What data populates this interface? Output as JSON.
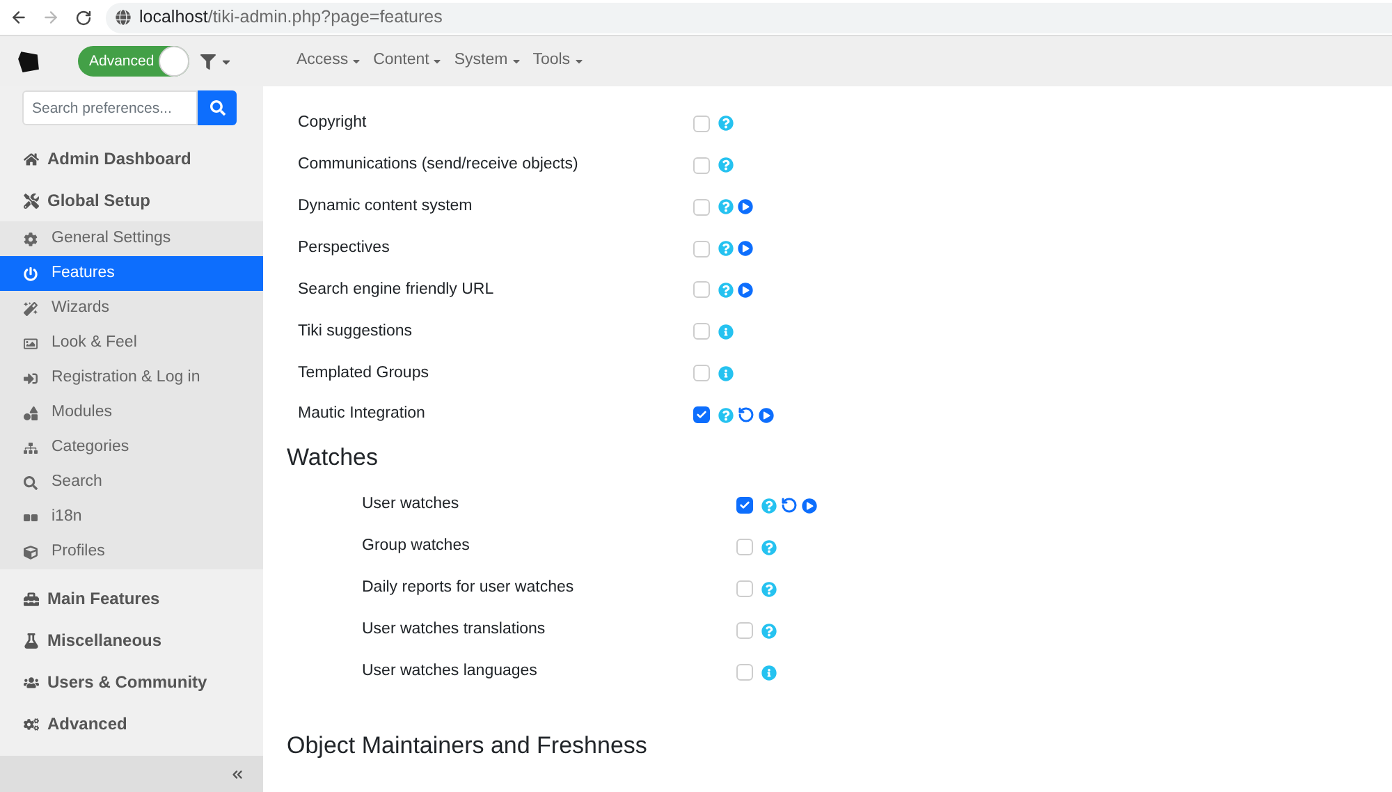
{
  "browser": {
    "url": {
      "host": "localhost",
      "path": "/tiki-admin.php?page=features"
    }
  },
  "topbar": {
    "mode_toggle": {
      "label": "Advanced",
      "on": true
    },
    "menus": [
      {
        "label": "Access"
      },
      {
        "label": "Content"
      },
      {
        "label": "System"
      },
      {
        "label": "Tools"
      }
    ]
  },
  "sidebar": {
    "search": {
      "placeholder": "Search preferences..."
    },
    "sections": [
      {
        "label": "Admin Dashboard"
      },
      {
        "label": "Global Setup",
        "children": [
          {
            "label": "General Settings",
            "selected": false
          },
          {
            "label": "Features",
            "selected": true
          },
          {
            "label": "Wizards",
            "selected": false
          },
          {
            "label": "Look & Feel",
            "selected": false
          },
          {
            "label": "Registration & Log in",
            "selected": false
          },
          {
            "label": "Modules",
            "selected": false
          },
          {
            "label": "Categories",
            "selected": false
          },
          {
            "label": "Search",
            "selected": false
          },
          {
            "label": "i18n",
            "selected": false
          },
          {
            "label": "Profiles",
            "selected": false
          }
        ]
      },
      {
        "label": "Main Features"
      },
      {
        "label": "Miscellaneous"
      },
      {
        "label": "Users & Community"
      },
      {
        "label": "Advanced"
      }
    ]
  },
  "content": {
    "preferences": [
      {
        "label": "Copyright",
        "checked": false,
        "actions": [
          {
            "kind": "help"
          }
        ]
      },
      {
        "label": "Communications (send/receive objects)",
        "checked": false,
        "actions": [
          {
            "kind": "help"
          }
        ]
      },
      {
        "label": "Dynamic content system",
        "checked": false,
        "actions": [
          {
            "kind": "help"
          },
          {
            "kind": "play"
          }
        ]
      },
      {
        "label": "Perspectives",
        "checked": false,
        "actions": [
          {
            "kind": "help"
          },
          {
            "kind": "play"
          }
        ]
      },
      {
        "label": "Search engine friendly URL",
        "checked": false,
        "actions": [
          {
            "kind": "help"
          },
          {
            "kind": "play"
          }
        ]
      },
      {
        "label": "Tiki suggestions",
        "checked": false,
        "actions": [
          {
            "kind": "info"
          }
        ]
      },
      {
        "label": "Templated Groups",
        "checked": false,
        "actions": [
          {
            "kind": "info"
          }
        ]
      },
      {
        "label": "Mautic Integration",
        "checked": true,
        "actions": [
          {
            "kind": "help"
          },
          {
            "kind": "reset"
          },
          {
            "kind": "play"
          }
        ]
      }
    ],
    "sections": [
      {
        "title": "Watches",
        "preferences": [
          {
            "label": "User watches",
            "checked": true,
            "actions": [
              {
                "kind": "help"
              },
              {
                "kind": "reset"
              },
              {
                "kind": "play"
              }
            ]
          },
          {
            "label": "Group watches",
            "checked": false,
            "actions": [
              {
                "kind": "help"
              }
            ]
          },
          {
            "label": "Daily reports for user watches",
            "checked": false,
            "actions": [
              {
                "kind": "help"
              }
            ]
          },
          {
            "label": "User watches translations",
            "checked": false,
            "actions": [
              {
                "kind": "help"
              }
            ]
          },
          {
            "label": "User watches languages",
            "checked": false,
            "actions": [
              {
                "kind": "info"
              }
            ]
          }
        ]
      },
      {
        "title": "Object Maintainers and Freshness"
      }
    ]
  }
}
